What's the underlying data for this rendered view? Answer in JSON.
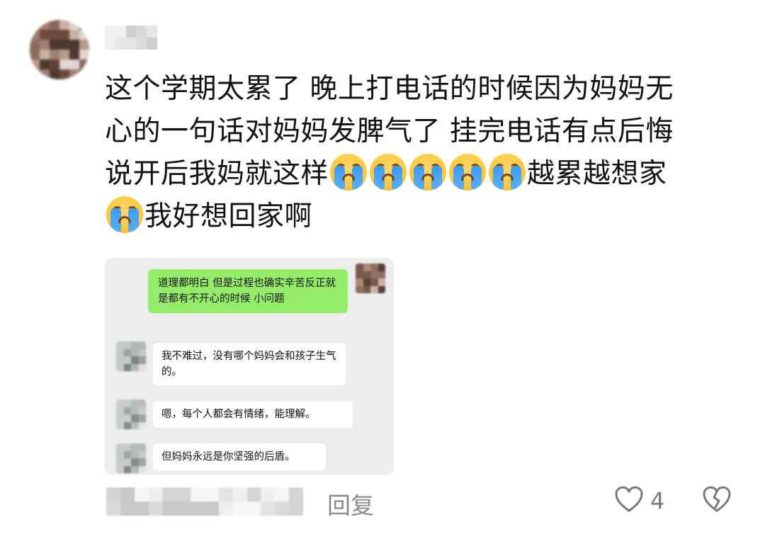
{
  "comment": {
    "lines": [
      "这个学期太累了 晚上打电话的时候因为妈妈无",
      "心的一句话对妈妈发脾气了 挂完电话有点后悔",
      "说开后我妈就这样",
      "越累越想家",
      "我好想回家啊"
    ],
    "emoji": "loudly-crying-face"
  },
  "chat_screenshot": {
    "my_message": "道理都明白 但是过程也确实辛苦反正就是都有不开心的时候 小问题",
    "replies": [
      "我不难过，没有哪个妈妈会和孩子生气的。",
      "嗯，每个人都会有情绪，能理解。",
      "但妈妈永远是你坚强的后盾。"
    ]
  },
  "footer": {
    "reply_label": "回复",
    "like_count": "4"
  },
  "icons": {
    "like": "heart-outline-icon",
    "dislike": "broken-heart-icon"
  },
  "colors": {
    "my_bubble": "#95ec69",
    "screenshot_bg": "#ededed",
    "meta_gray": "#8a8a8a"
  }
}
